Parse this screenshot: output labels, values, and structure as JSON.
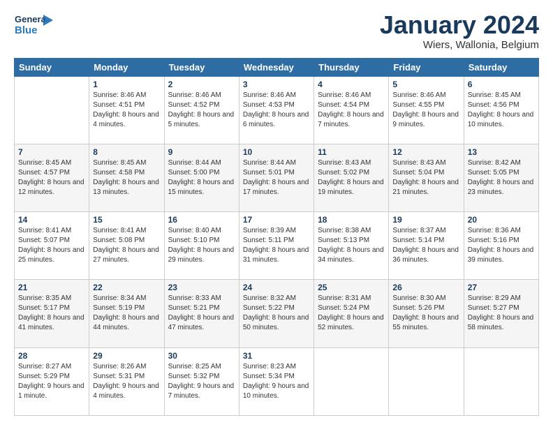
{
  "header": {
    "logo_general": "General",
    "logo_blue": "Blue",
    "month_title": "January 2024",
    "location": "Wiers, Wallonia, Belgium"
  },
  "days_of_week": [
    "Sunday",
    "Monday",
    "Tuesday",
    "Wednesday",
    "Thursday",
    "Friday",
    "Saturday"
  ],
  "weeks": [
    [
      {
        "day": "",
        "sunrise": "",
        "sunset": "",
        "daylight": ""
      },
      {
        "day": "1",
        "sunrise": "Sunrise: 8:46 AM",
        "sunset": "Sunset: 4:51 PM",
        "daylight": "Daylight: 8 hours and 4 minutes."
      },
      {
        "day": "2",
        "sunrise": "Sunrise: 8:46 AM",
        "sunset": "Sunset: 4:52 PM",
        "daylight": "Daylight: 8 hours and 5 minutes."
      },
      {
        "day": "3",
        "sunrise": "Sunrise: 8:46 AM",
        "sunset": "Sunset: 4:53 PM",
        "daylight": "Daylight: 8 hours and 6 minutes."
      },
      {
        "day": "4",
        "sunrise": "Sunrise: 8:46 AM",
        "sunset": "Sunset: 4:54 PM",
        "daylight": "Daylight: 8 hours and 7 minutes."
      },
      {
        "day": "5",
        "sunrise": "Sunrise: 8:46 AM",
        "sunset": "Sunset: 4:55 PM",
        "daylight": "Daylight: 8 hours and 9 minutes."
      },
      {
        "day": "6",
        "sunrise": "Sunrise: 8:45 AM",
        "sunset": "Sunset: 4:56 PM",
        "daylight": "Daylight: 8 hours and 10 minutes."
      }
    ],
    [
      {
        "day": "7",
        "sunrise": "Sunrise: 8:45 AM",
        "sunset": "Sunset: 4:57 PM",
        "daylight": "Daylight: 8 hours and 12 minutes."
      },
      {
        "day": "8",
        "sunrise": "Sunrise: 8:45 AM",
        "sunset": "Sunset: 4:58 PM",
        "daylight": "Daylight: 8 hours and 13 minutes."
      },
      {
        "day": "9",
        "sunrise": "Sunrise: 8:44 AM",
        "sunset": "Sunset: 5:00 PM",
        "daylight": "Daylight: 8 hours and 15 minutes."
      },
      {
        "day": "10",
        "sunrise": "Sunrise: 8:44 AM",
        "sunset": "Sunset: 5:01 PM",
        "daylight": "Daylight: 8 hours and 17 minutes."
      },
      {
        "day": "11",
        "sunrise": "Sunrise: 8:43 AM",
        "sunset": "Sunset: 5:02 PM",
        "daylight": "Daylight: 8 hours and 19 minutes."
      },
      {
        "day": "12",
        "sunrise": "Sunrise: 8:43 AM",
        "sunset": "Sunset: 5:04 PM",
        "daylight": "Daylight: 8 hours and 21 minutes."
      },
      {
        "day": "13",
        "sunrise": "Sunrise: 8:42 AM",
        "sunset": "Sunset: 5:05 PM",
        "daylight": "Daylight: 8 hours and 23 minutes."
      }
    ],
    [
      {
        "day": "14",
        "sunrise": "Sunrise: 8:41 AM",
        "sunset": "Sunset: 5:07 PM",
        "daylight": "Daylight: 8 hours and 25 minutes."
      },
      {
        "day": "15",
        "sunrise": "Sunrise: 8:41 AM",
        "sunset": "Sunset: 5:08 PM",
        "daylight": "Daylight: 8 hours and 27 minutes."
      },
      {
        "day": "16",
        "sunrise": "Sunrise: 8:40 AM",
        "sunset": "Sunset: 5:10 PM",
        "daylight": "Daylight: 8 hours and 29 minutes."
      },
      {
        "day": "17",
        "sunrise": "Sunrise: 8:39 AM",
        "sunset": "Sunset: 5:11 PM",
        "daylight": "Daylight: 8 hours and 31 minutes."
      },
      {
        "day": "18",
        "sunrise": "Sunrise: 8:38 AM",
        "sunset": "Sunset: 5:13 PM",
        "daylight": "Daylight: 8 hours and 34 minutes."
      },
      {
        "day": "19",
        "sunrise": "Sunrise: 8:37 AM",
        "sunset": "Sunset: 5:14 PM",
        "daylight": "Daylight: 8 hours and 36 minutes."
      },
      {
        "day": "20",
        "sunrise": "Sunrise: 8:36 AM",
        "sunset": "Sunset: 5:16 PM",
        "daylight": "Daylight: 8 hours and 39 minutes."
      }
    ],
    [
      {
        "day": "21",
        "sunrise": "Sunrise: 8:35 AM",
        "sunset": "Sunset: 5:17 PM",
        "daylight": "Daylight: 8 hours and 41 minutes."
      },
      {
        "day": "22",
        "sunrise": "Sunrise: 8:34 AM",
        "sunset": "Sunset: 5:19 PM",
        "daylight": "Daylight: 8 hours and 44 minutes."
      },
      {
        "day": "23",
        "sunrise": "Sunrise: 8:33 AM",
        "sunset": "Sunset: 5:21 PM",
        "daylight": "Daylight: 8 hours and 47 minutes."
      },
      {
        "day": "24",
        "sunrise": "Sunrise: 8:32 AM",
        "sunset": "Sunset: 5:22 PM",
        "daylight": "Daylight: 8 hours and 50 minutes."
      },
      {
        "day": "25",
        "sunrise": "Sunrise: 8:31 AM",
        "sunset": "Sunset: 5:24 PM",
        "daylight": "Daylight: 8 hours and 52 minutes."
      },
      {
        "day": "26",
        "sunrise": "Sunrise: 8:30 AM",
        "sunset": "Sunset: 5:26 PM",
        "daylight": "Daylight: 8 hours and 55 minutes."
      },
      {
        "day": "27",
        "sunrise": "Sunrise: 8:29 AM",
        "sunset": "Sunset: 5:27 PM",
        "daylight": "Daylight: 8 hours and 58 minutes."
      }
    ],
    [
      {
        "day": "28",
        "sunrise": "Sunrise: 8:27 AM",
        "sunset": "Sunset: 5:29 PM",
        "daylight": "Daylight: 9 hours and 1 minute."
      },
      {
        "day": "29",
        "sunrise": "Sunrise: 8:26 AM",
        "sunset": "Sunset: 5:31 PM",
        "daylight": "Daylight: 9 hours and 4 minutes."
      },
      {
        "day": "30",
        "sunrise": "Sunrise: 8:25 AM",
        "sunset": "Sunset: 5:32 PM",
        "daylight": "Daylight: 9 hours and 7 minutes."
      },
      {
        "day": "31",
        "sunrise": "Sunrise: 8:23 AM",
        "sunset": "Sunset: 5:34 PM",
        "daylight": "Daylight: 9 hours and 10 minutes."
      },
      {
        "day": "",
        "sunrise": "",
        "sunset": "",
        "daylight": ""
      },
      {
        "day": "",
        "sunrise": "",
        "sunset": "",
        "daylight": ""
      },
      {
        "day": "",
        "sunrise": "",
        "sunset": "",
        "daylight": ""
      }
    ]
  ]
}
